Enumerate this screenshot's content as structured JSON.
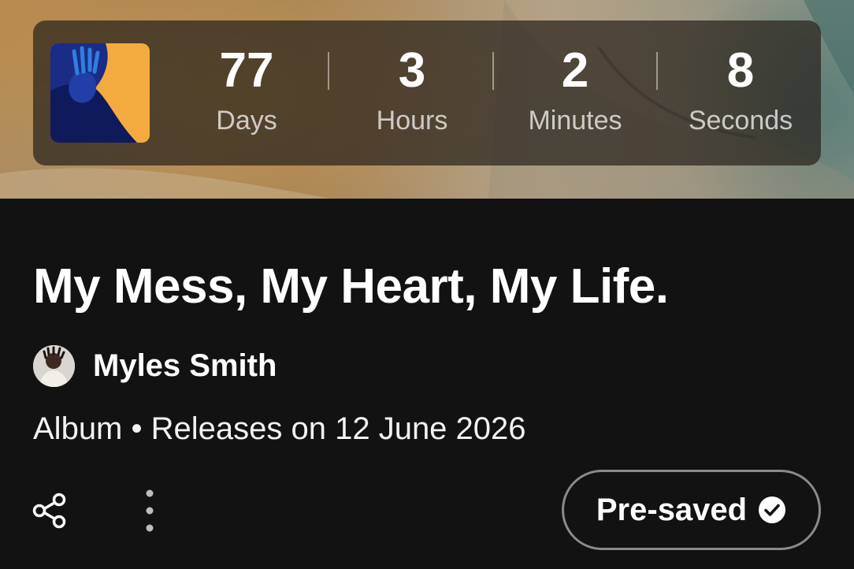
{
  "countdown": {
    "units": [
      {
        "value": "77",
        "label": "Days"
      },
      {
        "value": "3",
        "label": "Hours"
      },
      {
        "value": "2",
        "label": "Minutes"
      },
      {
        "value": "8",
        "label": "Seconds"
      }
    ]
  },
  "release": {
    "title": "My Mess, My Heart, My Life.",
    "artist": "Myles Smith",
    "meta": "Album • Releases on 12 June 2026"
  },
  "actions": {
    "share_icon": "share-icon",
    "more_icon": "more-options-icon",
    "presave_label": "Pre-saved",
    "presave_icon": "check-circle-icon"
  },
  "colors": {
    "background": "#121212",
    "text": "#ffffff",
    "countdown_panel": "rgba(40,34,28,0.72)",
    "button_border": "#8a8a8a"
  }
}
